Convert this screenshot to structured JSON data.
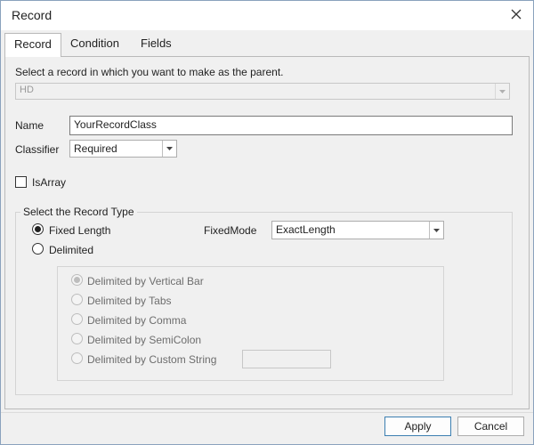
{
  "window": {
    "title": "Record"
  },
  "tabs": [
    {
      "label": "Record"
    },
    {
      "label": "Condition"
    },
    {
      "label": "Fields"
    }
  ],
  "record": {
    "parent_prompt": "Select a record in which you want to make as the parent.",
    "parent_value": "HD",
    "name_label": "Name",
    "name_value": "YourRecordClass",
    "classifier_label": "Classifier",
    "classifier_value": "Required",
    "isarray_label": "IsArray",
    "isarray_checked": false
  },
  "record_type": {
    "group_title": "Select the Record Type",
    "fixed_length_label": "Fixed Length",
    "fixed_length_selected": true,
    "delimited_label": "Delimited",
    "fixedmode_label": "FixedMode",
    "fixedmode_value": "ExactLength",
    "delimiters": [
      {
        "label": "Delimited by Vertical Bar",
        "selected": true
      },
      {
        "label": "Delimited by Tabs",
        "selected": false
      },
      {
        "label": "Delimited by Comma",
        "selected": false
      },
      {
        "label": "Delimited by SemiColon",
        "selected": false
      },
      {
        "label": "Delimited by Custom String",
        "selected": false
      }
    ],
    "custom_string_value": ""
  },
  "buttons": {
    "apply": "Apply",
    "cancel": "Cancel"
  },
  "colors": {
    "border": "#8aa2bd",
    "background": "#f0f0f0",
    "accent": "#3c7fb1"
  },
  "icons": {
    "close": "close-icon",
    "dropdown": "chevron-down-icon"
  }
}
